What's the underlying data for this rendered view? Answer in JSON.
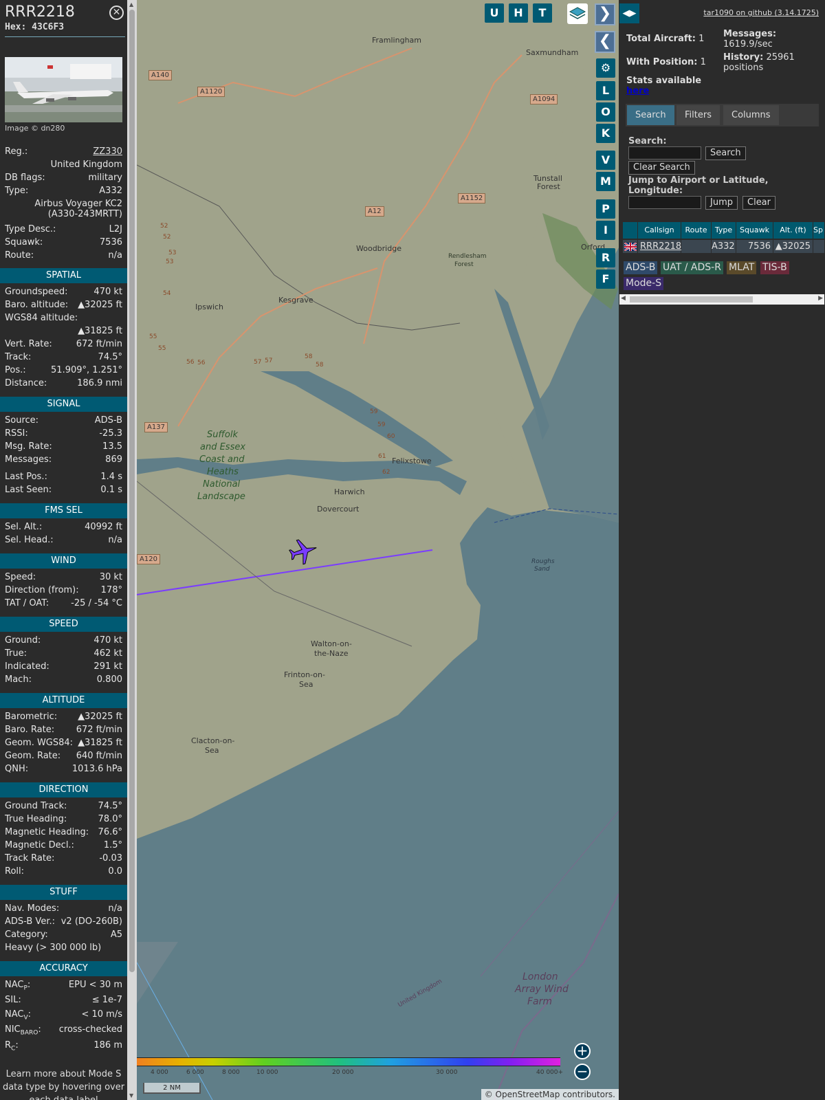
{
  "aircraft": {
    "callsign": "RRR2218",
    "hex": "Hex: 43C6F3",
    "image_credit": "Image © dn280"
  },
  "details": {
    "reg_label": "Reg.:",
    "reg_value": "ZZ330",
    "country": "United Kingdom",
    "dbflags_label": "DB flags:",
    "dbflags_value": "military",
    "type_label": "Type:",
    "type_value": "A332",
    "model": "Airbus Voyager KC2",
    "model2": "(A330-243MRTT)",
    "typedesc_label": "Type Desc.:",
    "typedesc_value": "L2J",
    "squawk_label": "Squawk:",
    "squawk_value": "7536",
    "route_label": "Route:",
    "route_value": "n/a"
  },
  "sections": {
    "spatial": "SPATIAL",
    "signal": "SIGNAL",
    "fms": "FMS SEL",
    "wind": "WIND",
    "speed": "SPEED",
    "altitude": "ALTITUDE",
    "direction": "DIRECTION",
    "stuff": "STUFF",
    "accuracy": "ACCURACY"
  },
  "spatial": {
    "gs_label": "Groundspeed:",
    "gs_value": "470 kt",
    "baro_label": "Baro. altitude:",
    "baro_value": "▲32025 ft",
    "wgs_label": "WGS84 altitude:",
    "wgs_value": "▲31825 ft",
    "vr_label": "Vert. Rate:",
    "vr_value": "672 ft/min",
    "track_label": "Track:",
    "track_value": "74.5°",
    "pos_label": "Pos.:",
    "pos_value": "51.909°, 1.251°",
    "dist_label": "Distance:",
    "dist_value": "186.9 nmi"
  },
  "signal": {
    "source_label": "Source:",
    "source_value": "ADS-B",
    "rssi_label": "RSSI:",
    "rssi_value": "-25.3",
    "rate_label": "Msg. Rate:",
    "rate_value": "13.5",
    "msgs_label": "Messages:",
    "msgs_value": "869",
    "lastpos_label": "Last Pos.:",
    "lastpos_value": "1.4 s",
    "lastseen_label": "Last Seen:",
    "lastseen_value": "0.1 s"
  },
  "fms": {
    "alt_label": "Sel. Alt.:",
    "alt_value": "40992 ft",
    "head_label": "Sel. Head.:",
    "head_value": "n/a"
  },
  "wind": {
    "speed_label": "Speed:",
    "speed_value": "30 kt",
    "dir_label": "Direction (from):",
    "dir_value": "178°",
    "tat_label": "TAT / OAT:",
    "tat_value": "-25 / -54 °C"
  },
  "speed": {
    "ground_label": "Ground:",
    "ground_value": "470 kt",
    "true_label": "True:",
    "true_value": "462 kt",
    "ind_label": "Indicated:",
    "ind_value": "291 kt",
    "mach_label": "Mach:",
    "mach_value": "0.800"
  },
  "altitude": {
    "baro_label": "Barometric:",
    "baro_value": "▲32025 ft",
    "brate_label": "Baro. Rate:",
    "brate_value": "672 ft/min",
    "geom_label": "Geom. WGS84:",
    "geom_value": "▲31825 ft",
    "grate_label": "Geom. Rate:",
    "grate_value": "640 ft/min",
    "qnh_label": "QNH:",
    "qnh_value": "1013.6 hPa"
  },
  "direction": {
    "gt_label": "Ground Track:",
    "gt_value": "74.5°",
    "th_label": "True Heading:",
    "th_value": "78.0°",
    "mh_label": "Magnetic Heading:",
    "mh_value": "76.6°",
    "md_label": "Magnetic Decl.:",
    "md_value": "1.5°",
    "tr_label": "Track Rate:",
    "tr_value": "-0.03",
    "roll_label": "Roll:",
    "roll_value": "0.0"
  },
  "stuff": {
    "nav_label": "Nav. Modes:",
    "nav_value": "n/a",
    "adsb_label": "ADS-B Ver.:",
    "adsb_value": "v2 (DO-260B)",
    "cat_label": "Category:",
    "cat_value": "A5",
    "cat_desc": "Heavy (> 300 000 lb)"
  },
  "accuracy": {
    "nacp_label": "NAC",
    "nacp_sub": "P",
    "nacp_value": "EPU < 30 m",
    "sil_label": "SIL:",
    "sil_value": "≤ 1e-7",
    "nacv_label": "NAC",
    "nacv_sub": "V",
    "nacv_value": "< 10 m/s",
    "nic_label": "NIC",
    "nic_sub": "BARO",
    "nic_value": "cross-checked",
    "rc_label": "R",
    "rc_sub": "C",
    "rc_value": "186 m"
  },
  "learn_more": [
    "Learn more about Mode S",
    "data type by hovering over",
    "each data label"
  ],
  "map": {
    "places": [
      "Framlingham",
      "Saxmundham",
      "Tunstall",
      "Forest",
      "Woodbridge",
      "Rendlesham",
      "Forest",
      "Orford",
      "Ipswich",
      "Kesgrave",
      "Suffolk",
      "and Essex",
      "Coast and",
      "Heaths",
      "National",
      "Landscape",
      "Felixstowe",
      "Harwich",
      "Dovercourt",
      "Roughs",
      "Sand",
      "Walton-on-",
      "the-Naze",
      "Frinton-on-",
      "Sea",
      "Clacton-on-",
      "Sea",
      "London",
      "Array Wind",
      "Farm",
      "United Kingdom"
    ],
    "roads": [
      "A140",
      "A1120",
      "A1094",
      "A12",
      "A1152",
      "A137",
      "A120"
    ],
    "junctions": [
      "52",
      "52",
      "53",
      "53",
      "54",
      "55",
      "55",
      "56",
      "56",
      "57",
      "57",
      "58",
      "58",
      "59",
      "59",
      "60",
      "61",
      "62"
    ],
    "buttons_top": [
      "U",
      "H",
      "T"
    ],
    "buttons_side": [
      "L",
      "O",
      "K",
      "V",
      "M",
      "P",
      "I",
      "R",
      "F"
    ],
    "color_labels": [
      "4 000",
      "6 000",
      "8 000",
      "10 000",
      "20 000",
      "30 000",
      "40 000+"
    ],
    "scale": "2 NM",
    "attribution_prefix": "© ",
    "attribution_link": "OpenStreetMap",
    "attribution_suffix": " contributors.",
    "track_color": "#7a3cff",
    "water_color": "#607e88",
    "land_color": "#9fa18a"
  },
  "right": {
    "version": "tar1090 on github (3.14.1725)",
    "total_label": "Total Aircraft:",
    "total_value": "1",
    "withpos_label": "With Position:",
    "withpos_value": "1",
    "messages_label": "Messages:",
    "messages_value": "1619.9/sec",
    "history_label": "History:",
    "history_value": "25961",
    "history_unit": "positions",
    "stats_label": "Stats available",
    "stats_link": "here",
    "tabs": [
      "Search",
      "Filters",
      "Columns"
    ],
    "search_label": "Search:",
    "search_btn": "Search",
    "clear_search_btn": "Clear Search",
    "jump_label": "Jump to Airport or Latitude,",
    "jump_label2": "Longitude:",
    "jump_btn": "Jump",
    "clear_btn": "Clear",
    "table_headers": [
      "Callsign",
      "Route",
      "Type",
      "Squawk",
      "Alt. (ft)",
      "Sp"
    ],
    "table_row": {
      "callsign": "RRR2218",
      "route": "",
      "type": "A332",
      "squawk": "7536",
      "alt": "▲32025"
    },
    "tags": [
      "ADS-B",
      "UAT / ADS-R",
      "MLAT",
      "TIS-B",
      "Mode-S"
    ]
  }
}
